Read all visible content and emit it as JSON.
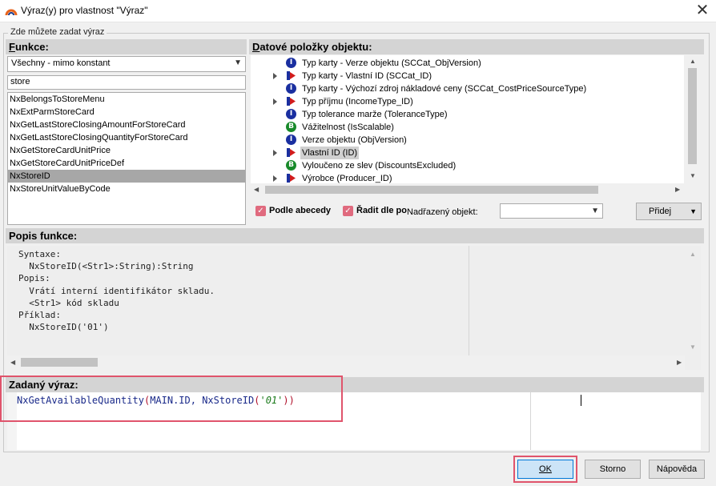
{
  "window": {
    "title": "Výraz(y) pro vlastnost \"Výraz\"",
    "close_glyph": "✕"
  },
  "group": {
    "legend": "Zde můžete zadat výraz"
  },
  "functions": {
    "header_first": "F",
    "header_rest": "unkce:",
    "filter_value": "Všechny - mimo konstant",
    "search_value": "store",
    "items": [
      "NxBelongsToStoreMenu",
      "NxExtParmStoreCard",
      "NxGetLastStoreClosingAmountForStoreCard",
      "NxGetLastStoreClosingQuantityForStoreCard",
      "NxGetStoreCardUnitPrice",
      "NxGetStoreCardUnitPriceDef",
      "NxStoreID",
      "NxStoreUnitValueByCode"
    ],
    "selected_index": 6
  },
  "data_items": {
    "header_first": "D",
    "header_rest": "atové položky objektu:",
    "rows": [
      {
        "icon": "info-icon",
        "label": "Typ karty - Verze objektu (SCCat_ObjVersion)"
      },
      {
        "icon": "link-icon",
        "label": "Typ karty - Vlastní ID (SCCat_ID)"
      },
      {
        "icon": "info-icon",
        "label": "Typ karty - Výchozí zdroj nákladové ceny (SCCat_CostPriceSourceType)"
      },
      {
        "icon": "link-icon",
        "label": "Typ příjmu (IncomeType_ID)"
      },
      {
        "icon": "info-icon",
        "label": "Typ tolerance marže (ToleranceType)"
      },
      {
        "icon": "bool-icon",
        "label": "Vážitelnost (IsScalable)"
      },
      {
        "icon": "info-icon",
        "label": "Verze objektu (ObjVersion)"
      },
      {
        "icon": "link-icon",
        "label": "Vlastní ID (ID)"
      },
      {
        "icon": "bool-icon",
        "label": "Vyloučeno ze slev (DiscountsExcluded)"
      },
      {
        "icon": "link-icon",
        "label": "Výrobce (Producer_ID)"
      }
    ],
    "selected_index": 7,
    "sort_alpha_label": "Podle abecedy",
    "sort_by_label": "Řadit dle po",
    "parent_label": "Nadřazený objekt:",
    "add_button": "Přidej"
  },
  "description": {
    "header": "Popis funkce:",
    "lines": [
      "Syntaxe:",
      "  NxStoreID(<Str1>:String):String",
      "Popis:",
      "  Vrátí interní identifikátor skladu.",
      "  <Str1> kód skladu",
      "Příklad:",
      "  NxStoreID('01')"
    ]
  },
  "expression": {
    "header": "Zadaný výraz:",
    "part_func": "NxGetAvailableQuantity",
    "part_open": "(",
    "part_args": "MAIN.ID, NxStoreID",
    "part_open2": "(",
    "part_str": "'01'",
    "part_close": "))"
  },
  "buttons": {
    "ok": "OK",
    "cancel": "Storno",
    "help": "Nápověda"
  },
  "colors": {
    "highlight": "#e0546c",
    "checkbox": "#e06a7e",
    "header_bg": "#d4d4d4"
  }
}
